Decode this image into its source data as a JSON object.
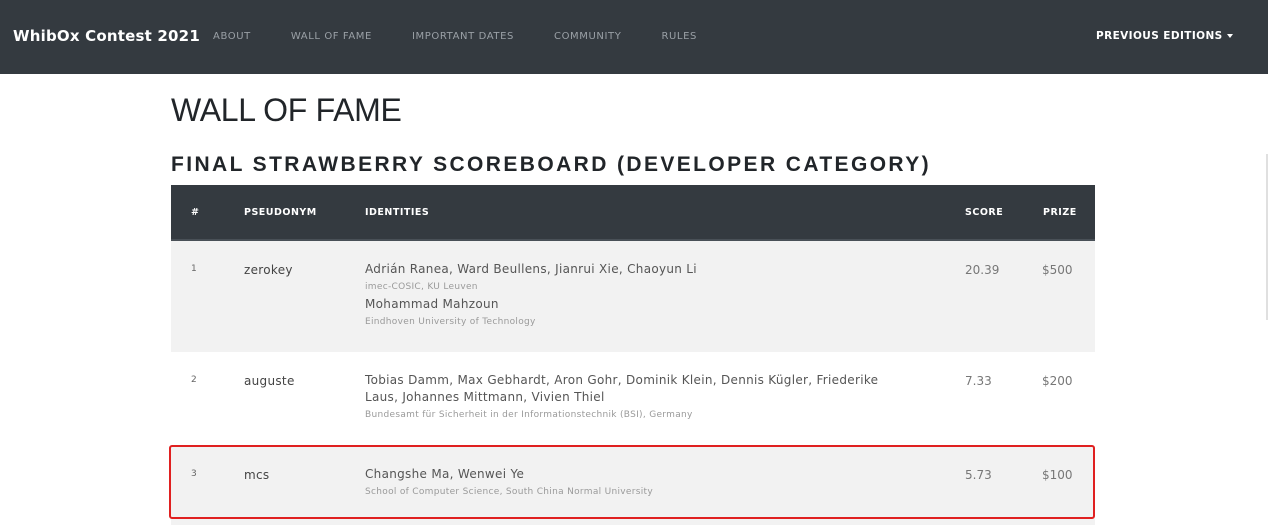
{
  "navbar": {
    "brand": "WhibOx Contest 2021",
    "links": [
      "ABOUT",
      "WALL OF FAME",
      "IMPORTANT DATES",
      "COMMUNITY",
      "RULES"
    ],
    "previous_editions": "PREVIOUS EDITIONS"
  },
  "page": {
    "title": "WALL OF FAME",
    "section_title": "FINAL STRAWBERRY SCOREBOARD (DEVELOPER CATEGORY)"
  },
  "table": {
    "headers": [
      "#",
      "PSEUDONYM",
      "IDENTITIES",
      "SCORE",
      "PRIZE"
    ],
    "rows": [
      {
        "rank": "1",
        "pseudonym": "zerokey",
        "names1": "Adrián Ranea, Ward Beullens, Jianrui Xie, Chaoyun Li",
        "affil1": "imec-COSIC, KU Leuven",
        "names2": "Mohammad Mahzoun",
        "affil2": "Eindhoven University of Technology",
        "score": "20.39",
        "prize": "$500"
      },
      {
        "rank": "2",
        "pseudonym": "auguste",
        "names1": "Tobias Damm, Max Gebhardt, Aron Gohr, Dominik Klein, Dennis Kügler, Friederike Laus, Johannes Mittmann, Vivien Thiel",
        "affil1": "Bundesamt für Sicherheit in der Informationstechnik (BSI), Germany",
        "score": "7.33",
        "prize": "$200"
      },
      {
        "rank": "3",
        "pseudonym": "mcs",
        "names1": "Changshe Ma, Wenwei Ye",
        "affil1": "School of Computer Science, South China Normal University",
        "score": "5.73",
        "prize": "$100"
      }
    ]
  },
  "colors": {
    "navbar_bg": "#343a40",
    "row_alt_bg": "#f2f2f2",
    "highlight_border": "#e02020"
  }
}
